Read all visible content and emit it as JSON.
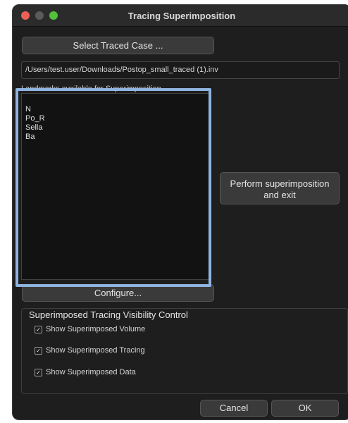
{
  "window": {
    "title": "Tracing Superimposition"
  },
  "select_button": "Select Traced Case ...",
  "file_path": "/Users/test.user/Downloads/Postop_small_traced (1).inv",
  "landmarks_label": "Landmarks available for Superimposition",
  "landmarks": [
    "N",
    "Po_R",
    "Sella",
    "Ba"
  ],
  "perform_button": {
    "line1": "Perform superimposition",
    "line2": "and exit"
  },
  "configure_button": "Configure...",
  "visibility": {
    "title": "Superimposed Tracing Visibility Control",
    "options": [
      {
        "label": "Show Superimposed Volume",
        "checked": true
      },
      {
        "label": "Show Superimposed Tracing",
        "checked": true
      },
      {
        "label": "Show Superimposed Data",
        "checked": true
      }
    ]
  },
  "cancel_button": "Cancel",
  "ok_button": "OK",
  "colors": {
    "background": "#1e1e1e",
    "highlight": "#8fb4e0",
    "close": "#ec5f57",
    "maximize": "#52c03b"
  }
}
